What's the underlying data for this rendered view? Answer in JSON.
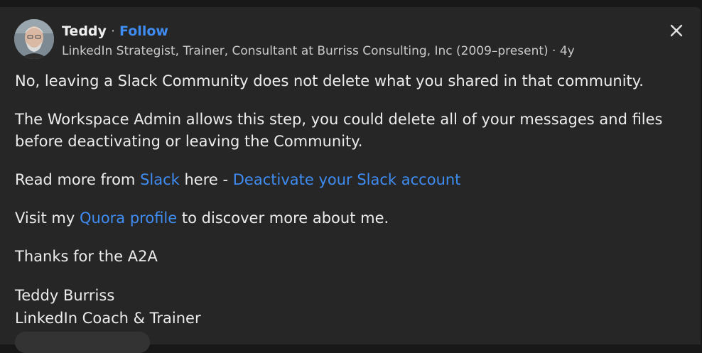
{
  "author": {
    "name": "Teddy",
    "separator": " · ",
    "follow_label": "Follow",
    "credential": "LinkedIn Strategist, Trainer, Consultant at Burriss Consulting, Inc (2009–present) · 4y"
  },
  "answer": {
    "p1": "No, leaving a Slack Community does not delete what you shared in that community.",
    "p2": "The Workspace Admin allows this step, you could delete all of your messages and files before deactivating or leaving the Community.",
    "p3_prefix": "Read more from ",
    "p3_link1": "Slack",
    "p3_middle": " here - ",
    "p3_link2": "Deactivate your Slack account",
    "p4_prefix": "Visit my ",
    "p4_link": "Quora profile",
    "p4_suffix": " to discover more about me.",
    "p5": "Thanks for the A2A",
    "sig_name": "Teddy Burriss",
    "sig_title": "LinkedIn Coach & Trainer"
  },
  "colors": {
    "link": "#3f8cf2",
    "card_bg": "#262626",
    "page_bg": "#181818"
  },
  "icons": [
    "close-icon"
  ]
}
